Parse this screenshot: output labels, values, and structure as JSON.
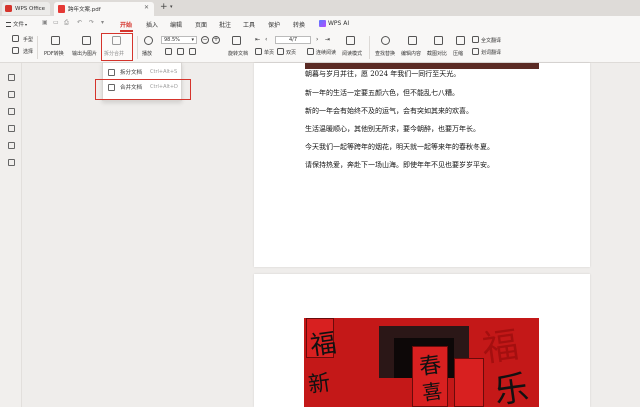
{
  "titlebar": {
    "home_tab": "WPS Office",
    "file_tab": "跨年文案.pdf"
  },
  "menubar": {
    "file_label": "文件",
    "tabs": [
      "开始",
      "插入",
      "编辑",
      "页面",
      "批注",
      "工具",
      "保护",
      "转换",
      "WPS AI"
    ],
    "active_tab": "开始"
  },
  "ribbon": {
    "hand_tool": "手型",
    "select_tool": "选择",
    "pdf_convert": "PDF转换",
    "export_image": "输出为图片",
    "split_merge": "拆分合并",
    "play": "播放",
    "zoom_level": "98.5%",
    "rotate_doc": "旋转文档",
    "page_indicator": "4/7",
    "single_page": "单页",
    "double_page": "双页",
    "continuous_read": "连续阅读",
    "read_mode": "阅读模式",
    "find_replace": "查找替换",
    "edit_content": "编辑内容",
    "screenshot_compare": "截图对比",
    "compress": "压缩",
    "full_translate": "全文翻译",
    "divide_translate": "划词翻译"
  },
  "dropdown": {
    "split_doc": "拆分文档",
    "split_shortcut": "Ctrl+Alt+S",
    "merge_doc": "合并文档",
    "merge_shortcut": "Ctrl+Alt+D"
  },
  "document": {
    "lines": [
      "朝暮与岁月并往，愿 2024 年我们一同行至天光。",
      "新一年的生活一定要五颜六色，但不能乱七八糟。",
      "新的一年会有始终不及的运气，会有突如其来的欢喜。",
      "生活温暖顺心，其他别无所求，要今朝醉，也要万年长。",
      "今天我们一起等跨年的烟花，明天就一起等来年的春秋冬夏。",
      "请保持热爱，奔赴下一场山海。即使年年不见也要岁岁平安。"
    ]
  },
  "colors": {
    "accent": "#d5342c",
    "titlebar_bg": "#dedbd8",
    "ribbon_bg": "#f8f7f6",
    "canvas_bg": "#efedeb"
  }
}
